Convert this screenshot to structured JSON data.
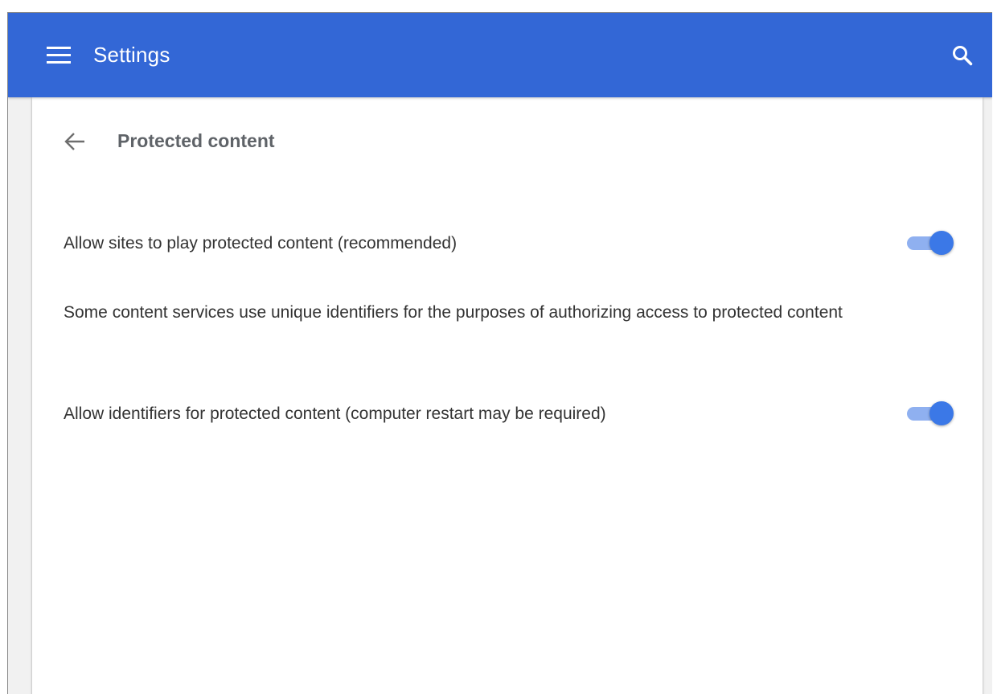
{
  "toolbar": {
    "title": "Settings",
    "menu_icon": "menu-icon",
    "search_icon": "search-icon",
    "background_color": "#3367d6"
  },
  "page": {
    "title": "Protected content",
    "back_icon": "arrow-back-icon"
  },
  "settings": {
    "allow_protected_content": {
      "label": "Allow sites to play protected content (recommended)",
      "enabled": true
    },
    "description": "Some content services use unique identifiers for the purposes of authorizing access to protected content",
    "allow_identifiers": {
      "label": "Allow identifiers for protected content (computer restart may be required)",
      "enabled": true
    }
  },
  "colors": {
    "accent": "#3b78e7",
    "toggle_track": "#8fb0f0",
    "text": "#333333"
  }
}
